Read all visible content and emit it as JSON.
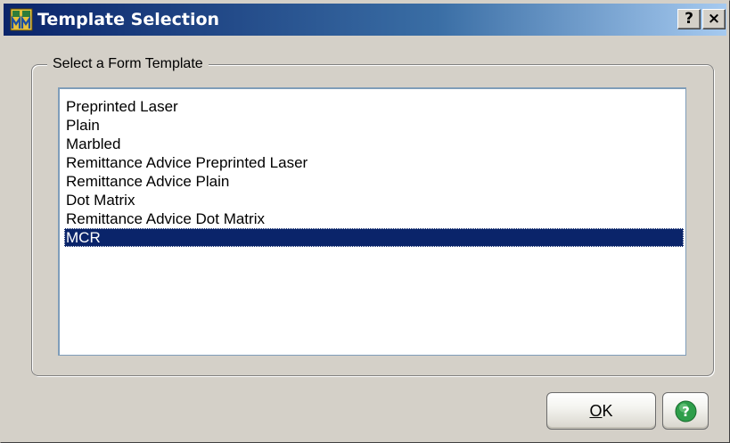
{
  "window": {
    "title": "Template Selection",
    "app_icon": "mas-app-icon",
    "help_caption_label": "?",
    "close_caption_label": "×"
  },
  "group": {
    "label": "Select a Form Template"
  },
  "templates": {
    "items": [
      "Preprinted Laser",
      "Plain",
      "Marbled",
      "Remittance Advice Preprinted Laser",
      "Remittance Advice Plain",
      "Dot Matrix",
      "Remittance Advice Dot Matrix",
      "MCR"
    ],
    "selected": "MCR"
  },
  "buttons": {
    "ok_mnemonic": "O",
    "ok_rest": "K",
    "help_icon": "help-icon"
  },
  "colors": {
    "title_gradient_start": "#0a246a",
    "selection": "#0a246a",
    "help_green": "#2e9e4a"
  }
}
